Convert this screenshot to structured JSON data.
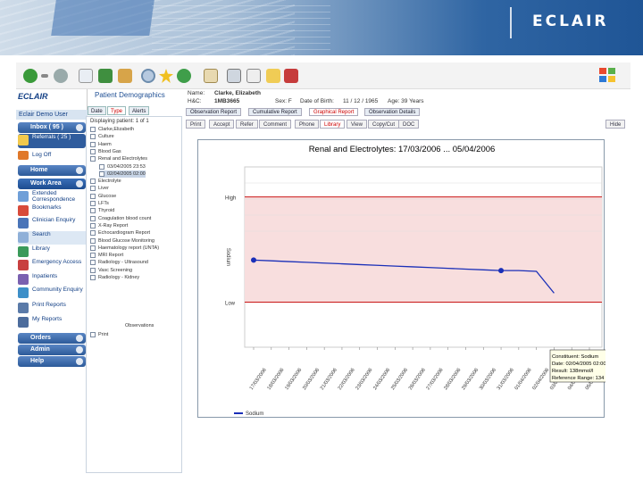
{
  "brand": "ECLAIR",
  "app": {
    "logo": "ECLAIR",
    "user": "Eclair Demo User"
  },
  "nav": {
    "top": [
      {
        "label": "Inbox ( 95 )"
      },
      {
        "label": "Referrals ( 25 )"
      },
      {
        "label": "Log Off"
      },
      {
        "label": "Home"
      }
    ],
    "work_area": "Work Area",
    "items": [
      "Extended Correspondence",
      "Bookmarks",
      "Clinician Enquiry",
      "Search",
      "Library",
      "Emergency Access",
      "Inpatients",
      "Community Enquiry",
      "Print Reports",
      "My Reports"
    ],
    "bottom": [
      "Orders",
      "Admin",
      "Help"
    ]
  },
  "patient": {
    "section": "Patient Demographics",
    "name_label": "Name:",
    "name": "Clarke, Elizabeth",
    "hcn_label": "H&C:",
    "hcn": "1MB3665",
    "sex": "Sex: F",
    "dob_label": "Date of Birth:",
    "dob": "11 / 12 / 1965",
    "age": "Age: 39 Years"
  },
  "left_tabs": [
    "Date",
    "Type",
    "Alerts"
  ],
  "left_tab_active": "Type",
  "tree": {
    "header": "Displaying patient:  1  of  1",
    "rows": [
      "Clarke,Elizabeth",
      "Culture",
      "Haem",
      "Blood Gas",
      "Renal and Electrolytes",
      "03/04/2005 23:53",
      "02/04/2005 02:00",
      "Electrolyte",
      "Liver",
      "Glucose",
      "LFTs",
      "Thyroid",
      "Coagulation blood count",
      "X-Ray Report",
      "Echocardiogram Report",
      "Blood Glucose Monitoring",
      "Haematology report (UNTA)",
      "MRI Report",
      "Radiology - Ultrasound",
      "Vasc Screening",
      "Radiology - Kidney"
    ],
    "footer": [
      "Observations",
      "Print"
    ]
  },
  "subtabs": [
    "Observation Report",
    "Cumulative Report",
    "Graphical Report",
    "Observation Details"
  ],
  "subtab_active": "Graphical Report",
  "actions": [
    "Print",
    "Accept",
    "Refer",
    "Comment",
    "Phone",
    "Library",
    "View",
    "Copy/Cut",
    "DOC",
    "Hide"
  ],
  "action_active": "Library",
  "chart_data": {
    "type": "line",
    "title": "Renal and Electrolytes: 17/03/2006 ... 05/04/2006",
    "ylabel": "Sodium",
    "x": [
      "17/03/2006",
      "18/03/2006",
      "19/03/2006",
      "20/03/2006",
      "21/03/2006",
      "22/03/2006",
      "23/03/2006",
      "24/03/2006",
      "25/03/2006",
      "26/03/2006",
      "27/03/2006",
      "28/03/2006",
      "29/03/2006",
      "30/03/2006",
      "31/03/2006",
      "01/04/2006",
      "02/04/2006",
      "03/04/2006",
      "04/04/2006",
      "05/04/2006"
    ],
    "series": [
      {
        "name": "Sodium",
        "values": [
          139.6,
          139.5,
          139.4,
          139.3,
          139.2,
          139.1,
          139.0,
          138.9,
          138.8,
          138.7,
          138.6,
          138.5,
          138.4,
          138.3,
          138.2,
          138.2,
          138.1,
          135.2,
          null,
          null
        ],
        "color": "#1a2fb8"
      }
    ],
    "ylim": [
      128,
      152
    ],
    "reference_high": 148,
    "reference_low": 134,
    "high_label": "High",
    "low_label": "Low",
    "high_band_color": "#f8dede",
    "reference_line_color": "#c81414",
    "tooltip": [
      "Constituent: Sodium",
      "Date: 02/04/2005 02:00",
      "Result: 138mmol/l",
      "Reference Range: 134 - 148"
    ]
  }
}
